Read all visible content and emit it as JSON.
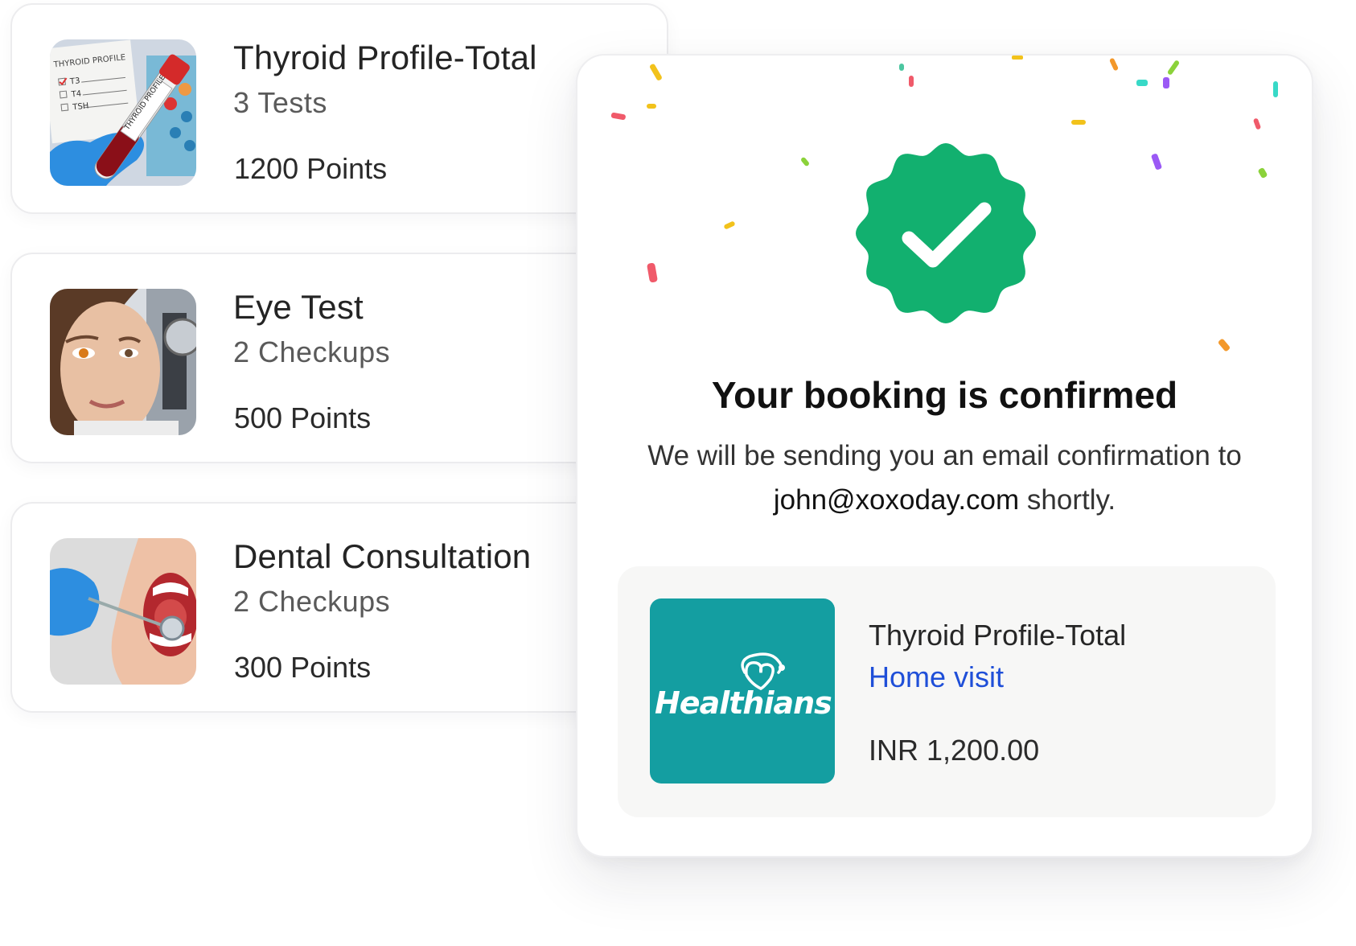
{
  "tests": [
    {
      "title": "Thyroid Profile-Total",
      "subtitle": "3 Tests",
      "points": "1200 Points",
      "image": "thyroid-blood-sample-image"
    },
    {
      "title": "Eye Test",
      "subtitle": "2 Checkups",
      "points": "500 Points",
      "image": "eye-exam-image"
    },
    {
      "title": "Dental Consultation",
      "subtitle": "2 Checkups",
      "points": "300 Points",
      "image": "dental-exam-image"
    }
  ],
  "thumbnail_text": {
    "form_title": "THYROID PROFILE",
    "form_items": [
      "T3",
      "T4",
      "TSH"
    ],
    "tube_label": "THYROID PROFILE"
  },
  "confirmation": {
    "icon": "verified-check-badge-icon",
    "badge_color": "#12b06f",
    "title": "Your booking is confirmed",
    "message_prefix": "We will be sending you an email confirmation to",
    "email": "john@xoxoday.com",
    "message_suffix": "shortly."
  },
  "booking": {
    "provider_name": "Healthians",
    "provider_color": "#149ea1",
    "test_name": "Thyroid Profile-Total",
    "visit_type": "Home visit",
    "visit_type_color": "#1f4fd8",
    "price": "INR 1,200.00"
  }
}
